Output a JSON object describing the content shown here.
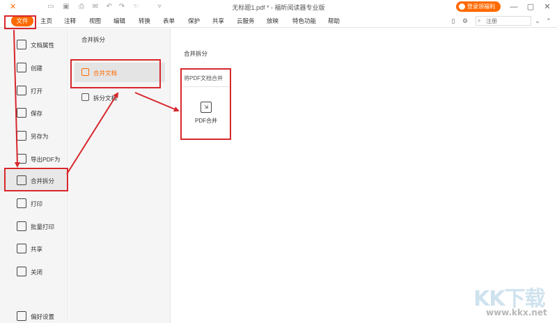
{
  "titlebar": {
    "doc_title": "无标题1.pdf * - 福昕阅读器专业版",
    "login_label": "登录领福利",
    "quick_icons": [
      "folder-icon",
      "save-icon",
      "print-icon",
      "mail-icon",
      "undo-icon",
      "redo-icon",
      "hand-icon",
      "customize-icon"
    ]
  },
  "menu": {
    "file": "文件",
    "items": [
      "主页",
      "注释",
      "视图",
      "编辑",
      "转换",
      "表单",
      "保护",
      "共享",
      "云服务",
      "放映",
      "特色功能",
      "帮助"
    ],
    "search_placeholder": "注册"
  },
  "sidebar": {
    "items": [
      {
        "label": "文档属性",
        "icon": "document-properties-icon"
      },
      {
        "label": "创建",
        "icon": "create-icon"
      },
      {
        "label": "打开",
        "icon": "open-icon"
      },
      {
        "label": "保存",
        "icon": "save-icon"
      },
      {
        "label": "另存为",
        "icon": "save-as-icon"
      },
      {
        "label": "导出PDF为",
        "icon": "export-icon"
      },
      {
        "label": "合并拆分",
        "icon": "merge-split-icon"
      },
      {
        "label": "打印",
        "icon": "print-icon"
      },
      {
        "label": "批量打印",
        "icon": "batch-print-icon"
      },
      {
        "label": "共享",
        "icon": "share-icon"
      },
      {
        "label": "关闭",
        "icon": "close-icon"
      }
    ],
    "settings_label": "偏好设置"
  },
  "submenu": {
    "title": "合并拆分",
    "items": [
      {
        "label": "合并文档",
        "icon": "merge-document-icon"
      },
      {
        "label": "拆分文档",
        "icon": "split-document-icon"
      }
    ]
  },
  "main": {
    "title": "合并拆分",
    "panel_subtitle": "将PDF文档合并",
    "card_label": "PDF合并"
  },
  "watermark": {
    "text": "KK下载",
    "url": "www.kkx.net"
  },
  "colors": {
    "accent": "#ff6a00",
    "annotation": "#d7262c"
  }
}
